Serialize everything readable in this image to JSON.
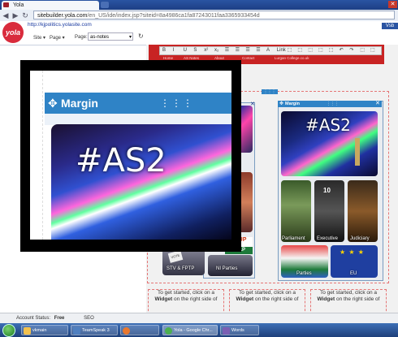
{
  "browser": {
    "tab_title": "Yola",
    "url_host": "sitebuilder.yola.com",
    "url_path": "/en_US/ide/index.jsp?siteid=8a4986ca1fa87243011faa3365933454d"
  },
  "yola": {
    "logo": "yola",
    "site_url": "http://kjpolitics.yolasite.com",
    "menu_site": "Site ▾",
    "menu_page": "Page ▾",
    "page_label": "Page:",
    "page_value": "as-notes",
    "top_right_label": "Vsb"
  },
  "toolbar": {
    "buttons": [
      "B",
      "I",
      "U",
      "S",
      "x²",
      "x₂",
      "☰",
      "☰",
      "☰",
      "☰",
      "A",
      "Link",
      "⬚",
      "⬚",
      "⬚",
      "⬚",
      "⬚",
      "↶",
      "↷",
      "⬚",
      "⬚"
    ],
    "nav_links": [
      "Home",
      "AS Notes",
      "About",
      "Contact",
      "Lurgan College.co.uk"
    ]
  },
  "panel": {
    "title": "Margin",
    "banner": "#AS2",
    "tiles": [
      {
        "label": "Parliament"
      },
      {
        "label": "Executive"
      },
      {
        "label": "Judiciary"
      },
      {
        "label": "Parties"
      },
      {
        "label": "EU"
      }
    ],
    "left_tiles": [
      {
        "label": "STV & FPTP"
      },
      {
        "label": "NI Parties"
      }
    ],
    "partial_logos": [
      "UUP",
      "SDLP",
      "VOTE"
    ]
  },
  "zoom": {
    "title": "Margin",
    "banner": "#AS2"
  },
  "get_started": {
    "text_before": "To get started, click on a ",
    "bold": "Widget",
    "text_after": " on the right side of"
  },
  "status": {
    "account_label": "Account Status:",
    "account_value": "Free",
    "seo": "SEO"
  },
  "taskbar": {
    "items": [
      {
        "label": "vkmain",
        "color": "#f2c14e"
      },
      {
        "label": "TeamSpeak 3",
        "color": "#4f7fbf"
      },
      {
        "label": "",
        "color": "#e8772e"
      },
      {
        "label": "Yola - Google Chr...",
        "color": "#4caf50"
      },
      {
        "label": "Words",
        "color": "#7b5fb3"
      }
    ]
  },
  "colors": {
    "chrome_blue": "#2a54a2",
    "yola_red": "#d92b3c",
    "site_red": "#c82323",
    "panel_blue": "#2f83c6"
  }
}
